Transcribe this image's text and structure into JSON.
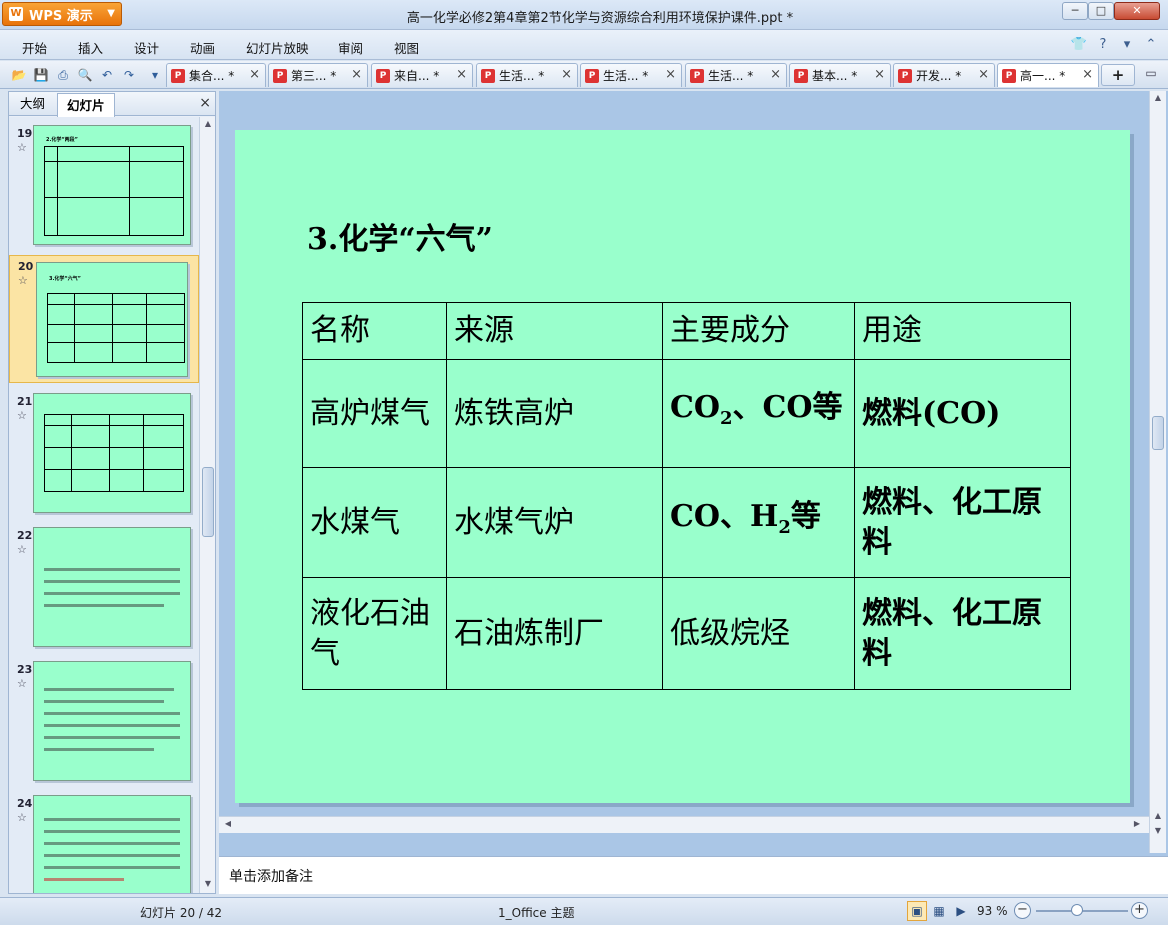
{
  "app": {
    "button_label": "WPS 演示",
    "window_title": "高一化学必修2第4章第2节化学与资源综合利用环境保护课件.ppt *"
  },
  "window_buttons": {
    "minimize": "─",
    "maximize": "□",
    "close": "✕"
  },
  "menu": [
    "开始",
    "插入",
    "设计",
    "动画",
    "幻灯片放映",
    "审阅",
    "视图"
  ],
  "doc_tabs": [
    {
      "label": "集合... *",
      "active": false
    },
    {
      "label": "第三... *",
      "active": false
    },
    {
      "label": "来自... *",
      "active": false
    },
    {
      "label": "生活... *",
      "active": false
    },
    {
      "label": "生活... *",
      "active": false
    },
    {
      "label": "生活... *",
      "active": false
    },
    {
      "label": "基本... *",
      "active": false
    },
    {
      "label": "开发... *",
      "active": false
    },
    {
      "label": "高一... *",
      "active": true
    }
  ],
  "panel": {
    "tabs": [
      "大纲",
      "幻灯片"
    ],
    "active_tab": "幻灯片",
    "thumbnails": [
      {
        "number": "19",
        "title": "2.化学“两段”",
        "selected": false
      },
      {
        "number": "20",
        "title": "3.化学“六气”",
        "selected": true
      },
      {
        "number": "21",
        "title": "",
        "selected": false
      },
      {
        "number": "22",
        "title": "",
        "selected": false
      },
      {
        "number": "23",
        "title": "",
        "selected": false
      },
      {
        "number": "24",
        "title": "",
        "selected": false
      }
    ]
  },
  "slide": {
    "title": "3.化学“六气”",
    "table": {
      "headers": [
        "名称",
        "来源",
        "主要成分",
        "用途"
      ],
      "rows": [
        {
          "name": "高炉煤气",
          "source": "炼铁高炉",
          "component_pre": "CO",
          "component_sub": "2",
          "component_post": "、CO等",
          "use": "燃料(CO)"
        },
        {
          "name": "水煤气",
          "source": "水煤气炉",
          "component_pre": "CO、H",
          "component_sub": "2",
          "component_post": "等",
          "use": "燃料、化工原料"
        },
        {
          "name": "液化石油气",
          "source": "石油炼制厂",
          "component_pre": "低级烷烃",
          "component_sub": "",
          "component_post": "",
          "use": "燃料、化工原料"
        }
      ]
    },
    "background_color": "#99ffcc"
  },
  "notes_placeholder": "单击添加备注",
  "status": {
    "slide_counter": "幻灯片 20 / 42",
    "theme": "1_Office 主题",
    "zoom": "93 %"
  }
}
